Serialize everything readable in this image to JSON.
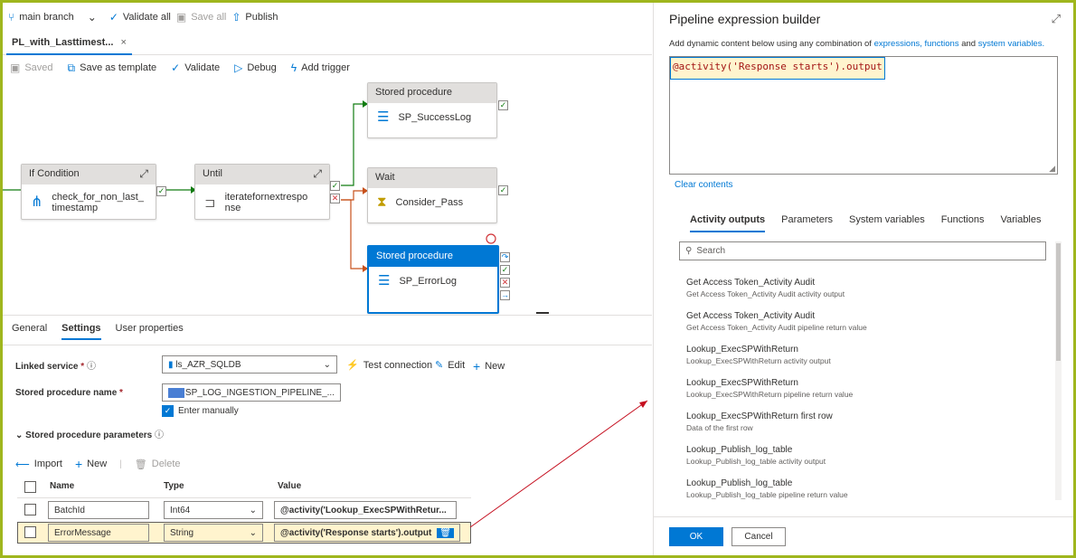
{
  "topbar": {
    "branch": "main branch",
    "validate_all": "Validate all",
    "save_all": "Save all",
    "publish": "Publish"
  },
  "tab": {
    "name": "PL_with_Lasttimest...",
    "close": "×"
  },
  "toolbar": {
    "saved": "Saved",
    "save_template": "Save as template",
    "validate": "Validate",
    "debug": "Debug",
    "add_trigger": "Add trigger"
  },
  "activities": {
    "if_condition": {
      "type": "If Condition",
      "name_line1": "check_for_non_last_",
      "name_line2": "timestamp"
    },
    "until": {
      "type": "Until",
      "name_line1": "iteratefornextrespo",
      "name_line2": "nse"
    },
    "sp_success": {
      "type": "Stored procedure",
      "name": "SP_SuccessLog"
    },
    "wait": {
      "type": "Wait",
      "name": "Consider_Pass"
    },
    "sp_error": {
      "type": "Stored procedure",
      "name": "SP_ErrorLog"
    }
  },
  "settings": {
    "tabs": [
      "General",
      "Settings",
      "User properties"
    ],
    "linked_service_label": "Linked service",
    "linked_service_value": "ls_AZR_SQLDB",
    "test_connection": "Test connection",
    "edit": "Edit",
    "new": "New",
    "sp_name_label": "Stored procedure name",
    "sp_name_value": "SP_LOG_INGESTION_PIPELINE_...",
    "enter_manually": "Enter manually",
    "sp_params_label": "Stored procedure parameters",
    "import": "Import",
    "new_param": "New",
    "delete": "Delete",
    "columns": {
      "name": "Name",
      "type": "Type",
      "value": "Value"
    },
    "rows": [
      {
        "name": "BatchId",
        "type": "Int64",
        "value": "@activity('Lookup_ExecSPWithRetur..."
      },
      {
        "name": "ErrorMessage",
        "type": "String",
        "value": "@activity('Response starts').output"
      }
    ]
  },
  "builder": {
    "title": "Pipeline expression builder",
    "desc_prefix": "Add dynamic content below using any combination of ",
    "link_expressions": "expressions,",
    "link_functions": "functions",
    "desc_and": " and ",
    "link_sysvars": "system variables.",
    "expression": "@activity('Response starts').output",
    "clear_contents": "Clear contents",
    "tabs": [
      "Activity outputs",
      "Parameters",
      "System variables",
      "Functions",
      "Variables"
    ],
    "search_placeholder": "Search",
    "items": [
      {
        "title": "Get Access Token_Activity Audit",
        "sub": "Get Access Token_Activity Audit activity output"
      },
      {
        "title": "Get Access Token_Activity Audit",
        "sub": "Get Access Token_Activity Audit pipeline return value"
      },
      {
        "title": "Lookup_ExecSPWithReturn",
        "sub": "Lookup_ExecSPWithReturn activity output"
      },
      {
        "title": "Lookup_ExecSPWithReturn",
        "sub": "Lookup_ExecSPWithReturn pipeline return value"
      },
      {
        "title": "Lookup_ExecSPWithReturn first row",
        "sub": "Data of the first row"
      },
      {
        "title": "Lookup_Publish_log_table",
        "sub": "Lookup_Publish_log_table activity output"
      },
      {
        "title": "Lookup_Publish_log_table",
        "sub": "Lookup_Publish_log_table pipeline return value"
      }
    ],
    "ok": "OK",
    "cancel": "Cancel"
  }
}
